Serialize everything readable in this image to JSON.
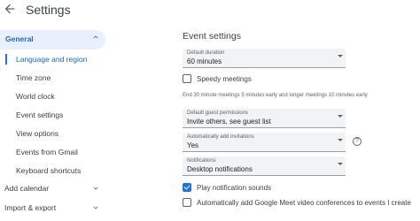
{
  "header": {
    "title": "Settings",
    "back_icon": "arrow-back-icon"
  },
  "sidebar": {
    "general_label": "General",
    "items": [
      {
        "label": "Language and region",
        "active": true
      },
      {
        "label": "Time zone"
      },
      {
        "label": "World clock"
      },
      {
        "label": "Event settings"
      },
      {
        "label": "View options"
      },
      {
        "label": "Events from Gmail"
      },
      {
        "label": "Keyboard shortcuts"
      }
    ],
    "add_calendar": "Add calendar",
    "import_export": "Import & export"
  },
  "main": {
    "section_title": "Event settings",
    "default_duration": {
      "label": "Default duration",
      "value": "60 minutes"
    },
    "speedy_meetings": {
      "label": "Speedy meetings",
      "checked": false
    },
    "speedy_note": "End 30 minute meetings 5 minutes early and longer meetings 10 minutes early",
    "guest_permissions": {
      "label": "Default guest permissions",
      "value": "Invite others, see guest list"
    },
    "add_invitations": {
      "label": "Automatically add invitations",
      "value": "Yes"
    },
    "notifications": {
      "label": "Notifications",
      "value": "Desktop notifications"
    },
    "play_sounds": {
      "label": "Play notification sounds",
      "checked": true
    },
    "meet_conferences": {
      "label": "Automatically add Google Meet video conferences to events I create",
      "checked": false
    }
  },
  "colors": {
    "accent": "#1a73e8",
    "selected_bg": "#e8f0fe",
    "field_bg": "#f1f3f4"
  }
}
